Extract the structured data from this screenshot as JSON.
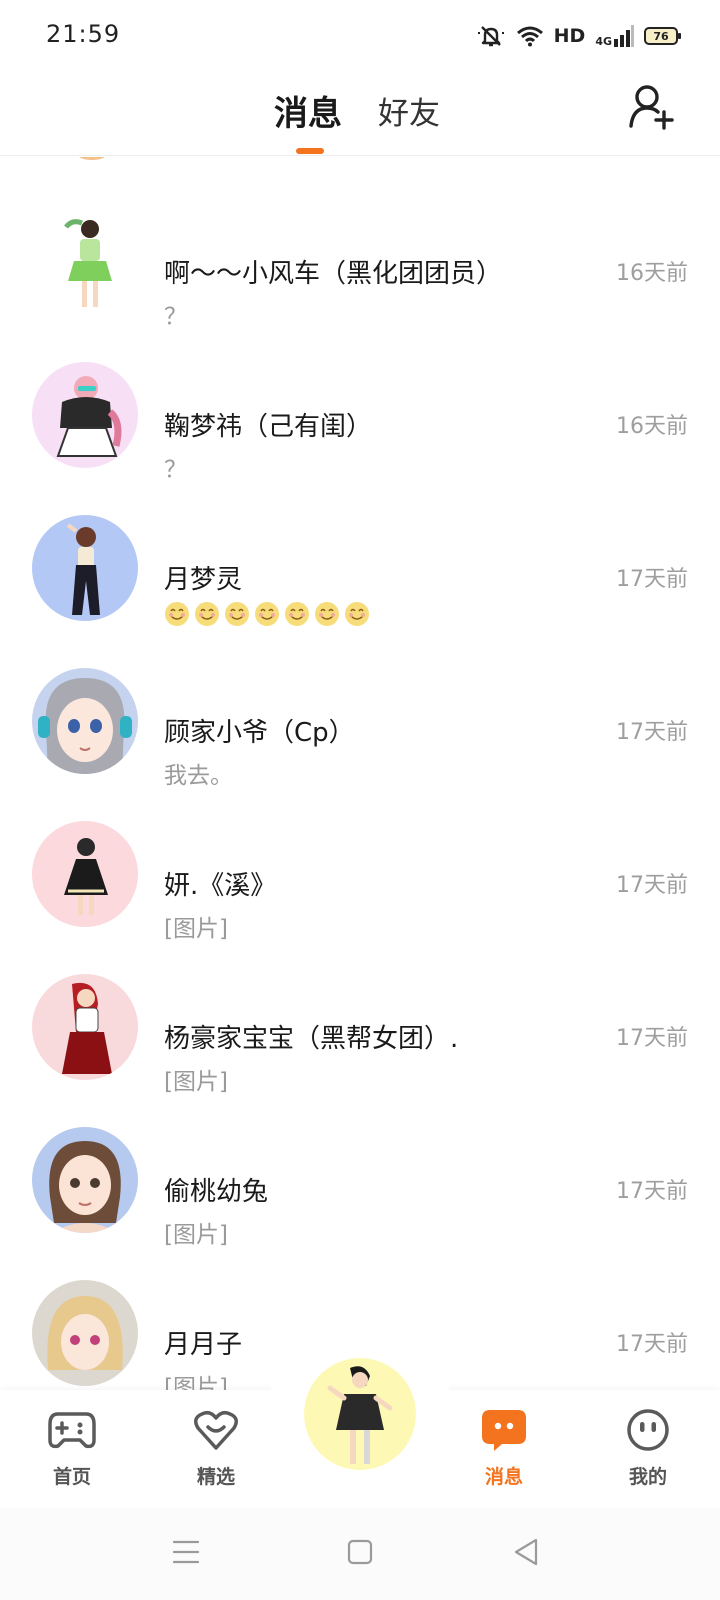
{
  "status_bar": {
    "time": "21:59",
    "network": "HD",
    "lte": "4G",
    "battery": "76"
  },
  "header": {
    "tabs": [
      {
        "label": "消息",
        "active": true
      },
      {
        "label": "好友",
        "active": false
      }
    ],
    "accent_color": "#f3731e"
  },
  "conversations": [
    {
      "name": "啊～～小风车（黑化团团员）",
      "preview": "？",
      "time": "16天前",
      "avatar_bg": "#ffffff"
    },
    {
      "name": "鞠梦祎（己有闺）",
      "preview": "？",
      "time": "16天前",
      "avatar_bg": "#f7e0f5"
    },
    {
      "name": "月梦灵",
      "preview": "",
      "emoji_count": 7,
      "time": "17天前",
      "avatar_bg": "#b4c8f5"
    },
    {
      "name": "顾家小爷（Cp）",
      "preview": "我去。",
      "time": "17天前",
      "avatar_bg": "#c5d3ee"
    },
    {
      "name": "妍.《溪》",
      "preview": "[图片]",
      "time": "17天前",
      "avatar_bg": "#fbd9dc"
    },
    {
      "name": "杨豪家宝宝（黑帮女团）.",
      "preview": "[图片]",
      "time": "17天前",
      "avatar_bg": "#f9dadc"
    },
    {
      "name": "偷桃幼兔",
      "preview": "[图片]",
      "time": "17天前",
      "avatar_bg": "#b6c9ef"
    },
    {
      "name": "月月子",
      "preview": "[图片]",
      "time": "17天前",
      "avatar_bg": "#ddd8cf"
    }
  ],
  "bottom_nav": {
    "home": "首页",
    "featured": "精选",
    "messages": "消息",
    "mine": "我的",
    "active": "messages"
  }
}
